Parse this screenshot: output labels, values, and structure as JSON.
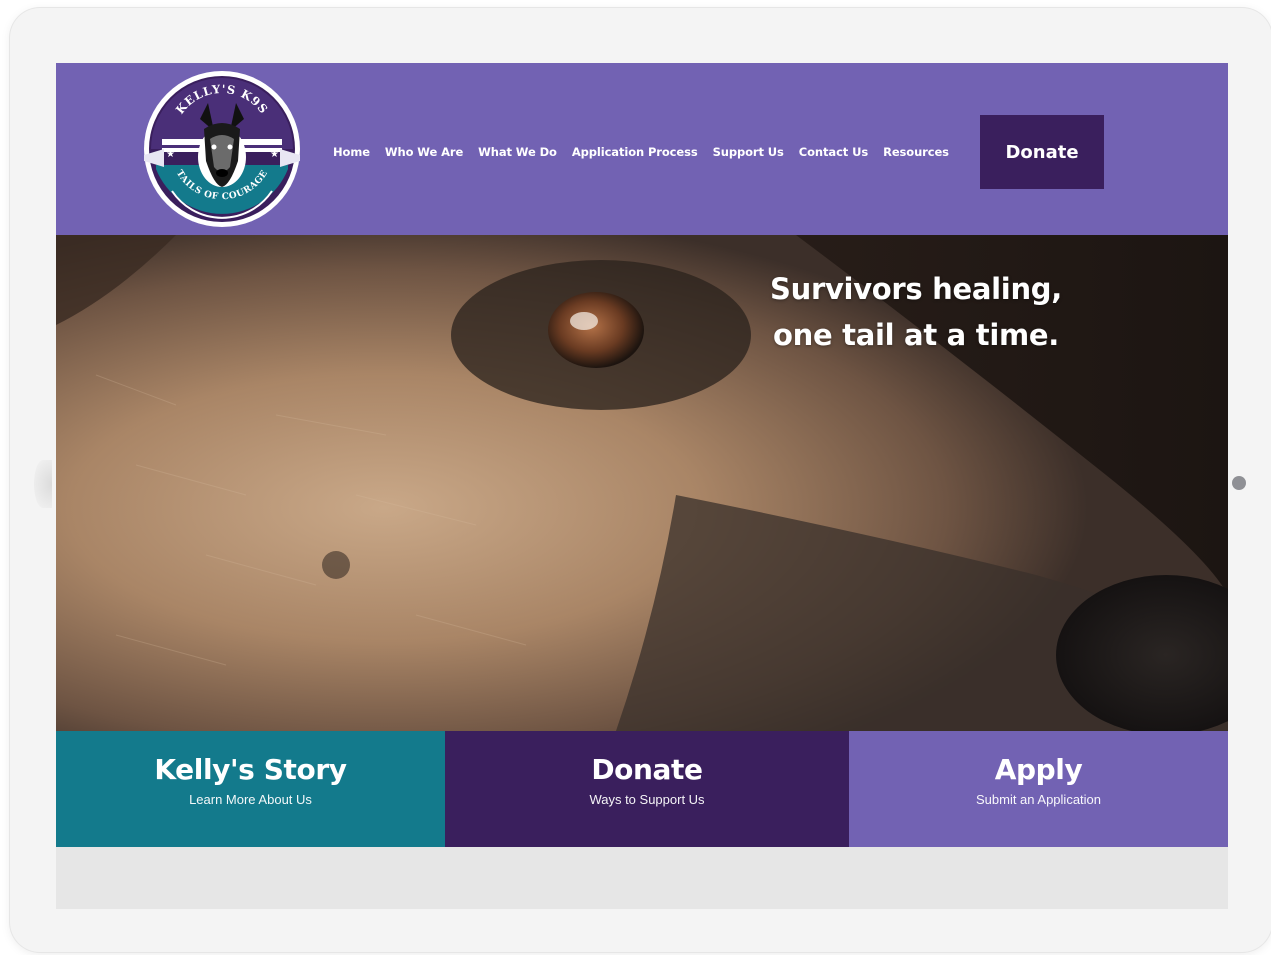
{
  "header": {
    "logo_text_top": "KELLY'S K9S",
    "logo_text_bottom": "TAILS OF COURAGE",
    "nav": [
      {
        "label": "Home"
      },
      {
        "label": "Who We Are"
      },
      {
        "label": "What We Do"
      },
      {
        "label": "Application Process"
      },
      {
        "label": "Support Us"
      },
      {
        "label": "Contact Us"
      },
      {
        "label": "Resources"
      }
    ],
    "donate_label": "Donate"
  },
  "hero": {
    "line1": "Survivors healing,",
    "line2": "one tail at a time."
  },
  "ctas": [
    {
      "title": "Kelly's Story",
      "subtitle": "Learn More About Us"
    },
    {
      "title": "Donate",
      "subtitle": "Ways to Support Us"
    },
    {
      "title": "Apply",
      "subtitle": "Submit an Application"
    }
  ],
  "colors": {
    "brand_purple": "#7262b3",
    "dark_purple": "#3a1f5d",
    "teal": "#137a8c"
  }
}
